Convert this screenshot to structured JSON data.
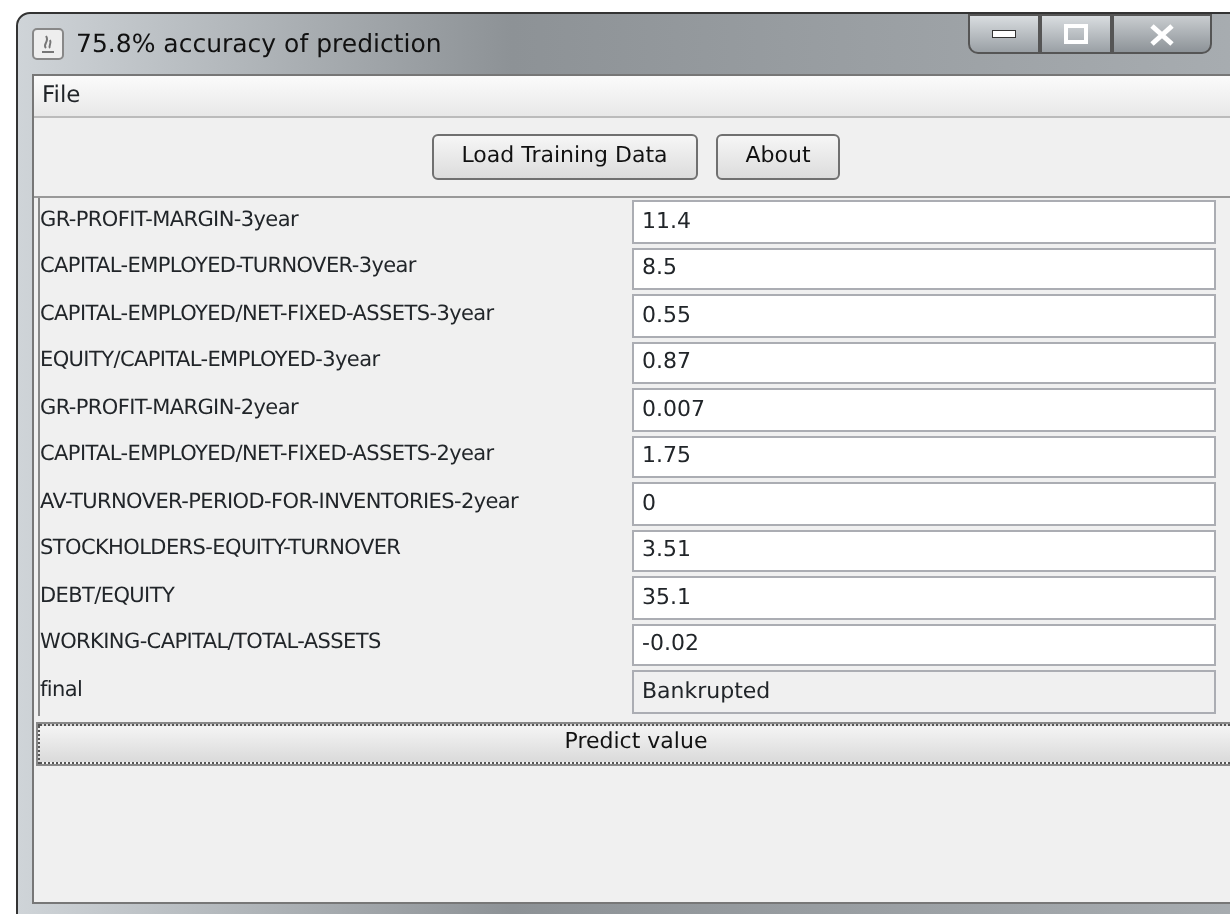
{
  "window": {
    "title": "75.8% accuracy of prediction"
  },
  "menu": [
    "File"
  ],
  "toolbar_buttons": [
    "Load Training Data",
    "About"
  ],
  "fields": [
    {
      "label": "GR-PROFIT-MARGIN-3year",
      "value": "11.4",
      "editable": true
    },
    {
      "label": "CAPITAL-EMPLOYED-TURNOVER-3year",
      "value": "8.5",
      "editable": true
    },
    {
      "label": "CAPITAL-EMPLOYED/NET-FIXED-ASSETS-3year",
      "value": "0.55",
      "editable": true
    },
    {
      "label": "EQUITY/CAPITAL-EMPLOYED-3year",
      "value": "0.87",
      "editable": true
    },
    {
      "label": "GR-PROFIT-MARGIN-2year",
      "value": "0.007",
      "editable": true
    },
    {
      "label": "CAPITAL-EMPLOYED/NET-FIXED-ASSETS-2year",
      "value": "1.75",
      "editable": true
    },
    {
      "label": "AV-TURNOVER-PERIOD-FOR-INVENTORIES-2year",
      "value": "0",
      "editable": true
    },
    {
      "label": "STOCKHOLDERS-EQUITY-TURNOVER",
      "value": "3.51",
      "editable": true
    },
    {
      "label": "DEBT/EQUITY",
      "value": "35.1",
      "editable": true
    },
    {
      "label": "WORKING-CAPITAL/TOTAL-ASSETS",
      "value": "-0.02",
      "editable": true
    },
    {
      "label": "final",
      "value": "Bankrupted",
      "editable": false
    }
  ],
  "predict_button": "Predict value"
}
